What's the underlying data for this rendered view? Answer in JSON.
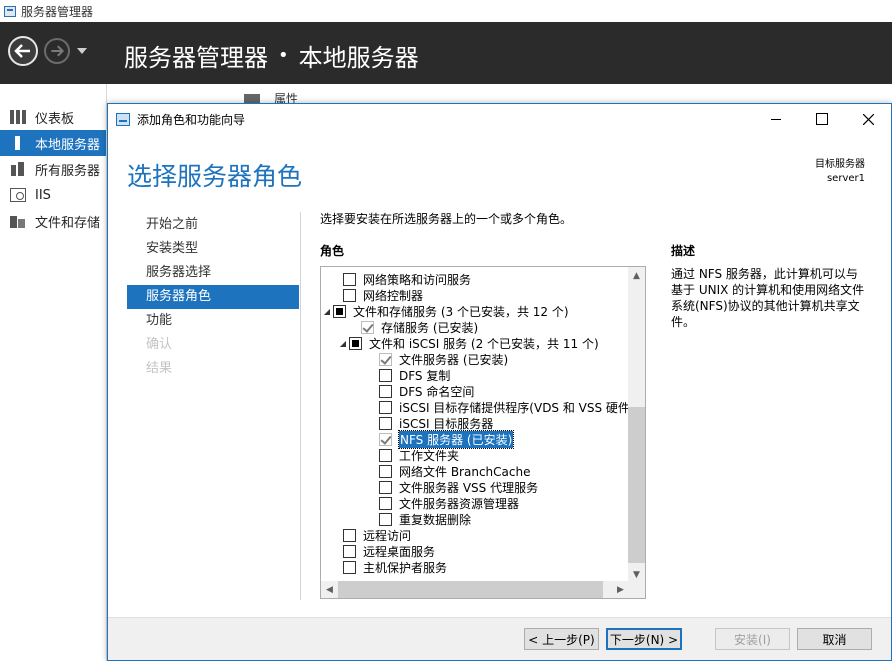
{
  "server_manager": {
    "window_title": "服务器管理器",
    "breadcrumb": {
      "root": "服务器管理器",
      "separator": "•",
      "current": "本地服务器"
    },
    "sidebar": {
      "items": [
        {
          "label": "仪表板",
          "icon": "dashboard-icon",
          "active": false
        },
        {
          "label": "本地服务器",
          "icon": "local-server-icon",
          "active": true
        },
        {
          "label": "所有服务器",
          "icon": "all-servers-icon",
          "active": false
        },
        {
          "label": "IIS",
          "icon": "iis-icon",
          "active": false
        },
        {
          "label": "文件和存储",
          "icon": "file-storage-icon",
          "active": false
        }
      ]
    },
    "properties_label": "属性"
  },
  "wizard": {
    "title": "添加角色和功能向导",
    "heading": "选择服务器角色",
    "target": {
      "label": "目标服务器",
      "server": "server1"
    },
    "steps": [
      {
        "label": "开始之前",
        "state": "normal"
      },
      {
        "label": "安装类型",
        "state": "normal"
      },
      {
        "label": "服务器选择",
        "state": "normal"
      },
      {
        "label": "服务器角色",
        "state": "active"
      },
      {
        "label": "功能",
        "state": "normal"
      },
      {
        "label": "确认",
        "state": "disabled"
      },
      {
        "label": "结果",
        "state": "disabled"
      }
    ],
    "instruction": "选择要安装在所选服务器上的一个或多个角色。",
    "roles_label": "角色",
    "description_label": "描述",
    "description_text": "通过 NFS 服务器，此计算机可以与基于 UNIX 的计算机和使用网络文件系统(NFS)协议的其他计算机共享文件。",
    "roles": [
      {
        "label": "网络策略和访问服务",
        "level": 0,
        "state": "unchecked",
        "expander": ""
      },
      {
        "label": "网络控制器",
        "level": 0,
        "state": "unchecked",
        "expander": ""
      },
      {
        "label": "文件和存储服务 (3 个已安装，共 12 个)",
        "level": 0,
        "state": "indeterminate",
        "expander": "◢"
      },
      {
        "label": "存储服务 (已安装)",
        "level": 1,
        "state": "checked",
        "expander": ""
      },
      {
        "label": "文件和 iSCSI 服务 (2 个已安装，共 11 个)",
        "level": 1,
        "state": "indeterminate",
        "expander": "◢"
      },
      {
        "label": "文件服务器 (已安装)",
        "level": 2,
        "state": "checked",
        "expander": ""
      },
      {
        "label": "DFS 复制",
        "level": 2,
        "state": "unchecked",
        "expander": ""
      },
      {
        "label": "DFS 命名空间",
        "level": 2,
        "state": "unchecked",
        "expander": ""
      },
      {
        "label": "iSCSI 目标存储提供程序(VDS 和 VSS 硬件",
        "level": 2,
        "state": "unchecked",
        "expander": ""
      },
      {
        "label": "iSCSI 目标服务器",
        "level": 2,
        "state": "unchecked",
        "expander": ""
      },
      {
        "label": "NFS 服务器 (已安装)",
        "level": 2,
        "state": "checked",
        "expander": "",
        "selected": true
      },
      {
        "label": "工作文件夹",
        "level": 2,
        "state": "unchecked",
        "expander": ""
      },
      {
        "label": "网络文件 BranchCache",
        "level": 2,
        "state": "unchecked",
        "expander": ""
      },
      {
        "label": "文件服务器 VSS 代理服务",
        "level": 2,
        "state": "unchecked",
        "expander": ""
      },
      {
        "label": "文件服务器资源管理器",
        "level": 2,
        "state": "unchecked",
        "expander": ""
      },
      {
        "label": "重复数据删除",
        "level": 2,
        "state": "unchecked",
        "expander": ""
      },
      {
        "label": "远程访问",
        "level": 0,
        "state": "unchecked",
        "expander": ""
      },
      {
        "label": "远程桌面服务",
        "level": 0,
        "state": "unchecked",
        "expander": ""
      },
      {
        "label": "主机保护者服务",
        "level": 0,
        "state": "unchecked",
        "expander": ""
      }
    ],
    "buttons": {
      "prev": "< 上一步(P)",
      "next": "下一步(N) >",
      "install": "安装(I)",
      "cancel": "取消"
    }
  }
}
